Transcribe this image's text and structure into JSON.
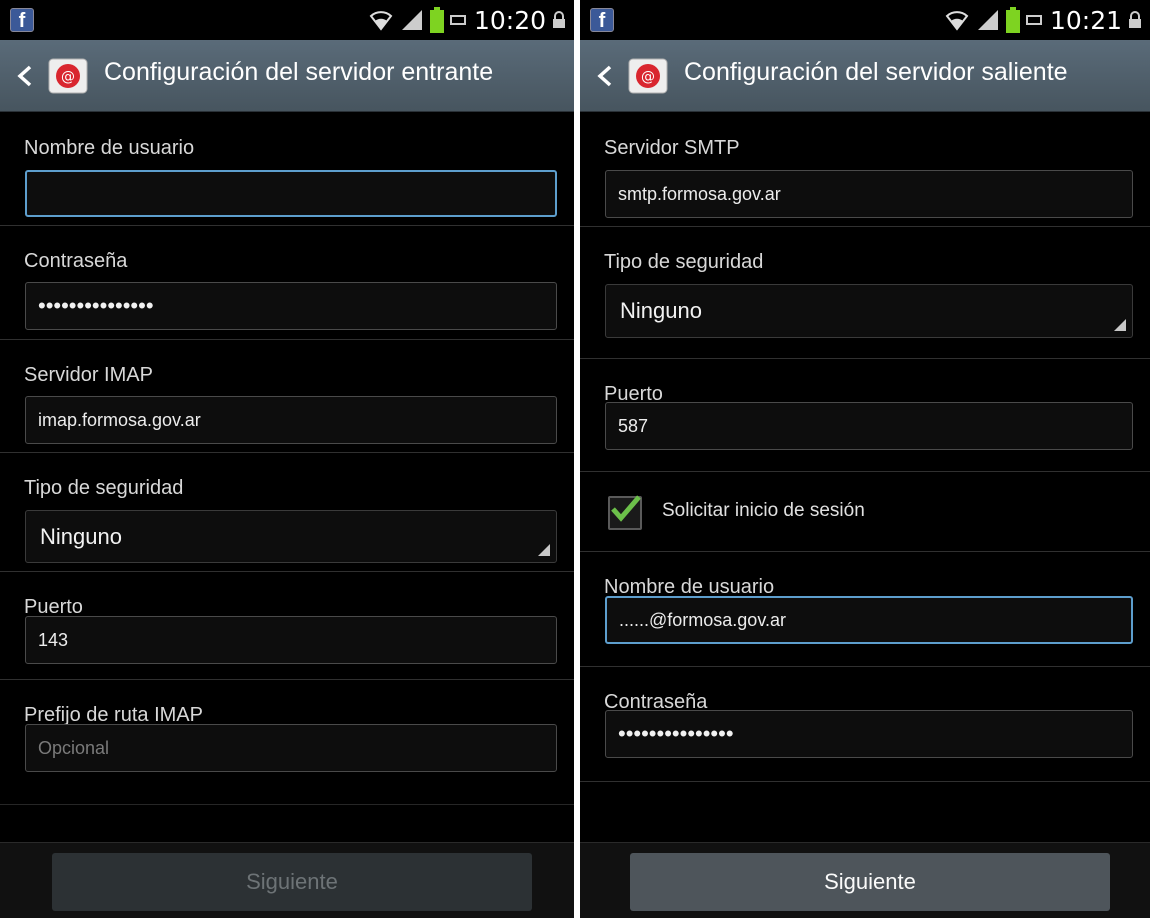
{
  "left": {
    "status": {
      "time": "10:20",
      "app_icon": "facebook-icon"
    },
    "title": "Configuración del servidor entrante",
    "fields": {
      "username": {
        "label": "Nombre de usuario",
        "value": ""
      },
      "password": {
        "label": "Contraseña",
        "value": "•••••••••••••••"
      },
      "imap_server": {
        "label": "Servidor IMAP",
        "value": "imap.formosa.gov.ar"
      },
      "security": {
        "label": "Tipo de seguridad",
        "value": "Ninguno"
      },
      "port": {
        "label": "Puerto",
        "value": "143"
      },
      "imap_prefix": {
        "label": "Prefijo de ruta IMAP",
        "placeholder": "Opcional"
      }
    },
    "next_label": "Siguiente",
    "next_enabled": false
  },
  "right": {
    "status": {
      "time": "10:21",
      "app_icon": "facebook-icon"
    },
    "title": "Configuración del servidor saliente",
    "fields": {
      "smtp_server": {
        "label": "Servidor SMTP",
        "value": "smtp.formosa.gov.ar"
      },
      "security": {
        "label": "Tipo de seguridad",
        "value": "Ninguno"
      },
      "port": {
        "label": "Puerto",
        "value": "587"
      },
      "require_signin": {
        "label": "Solicitar inicio de sesión",
        "checked": true
      },
      "username": {
        "label": "Nombre de usuario",
        "value": "......@formosa.gov.ar"
      },
      "password": {
        "label": "Contraseña",
        "value": "•••••••••••••••"
      }
    },
    "next_label": "Siguiente",
    "next_enabled": true
  },
  "colors": {
    "action_bar": "#4f5e6a",
    "focus_border": "#5d9ecd",
    "checkmark": "#6cc04a",
    "battery": "#7ed321"
  }
}
